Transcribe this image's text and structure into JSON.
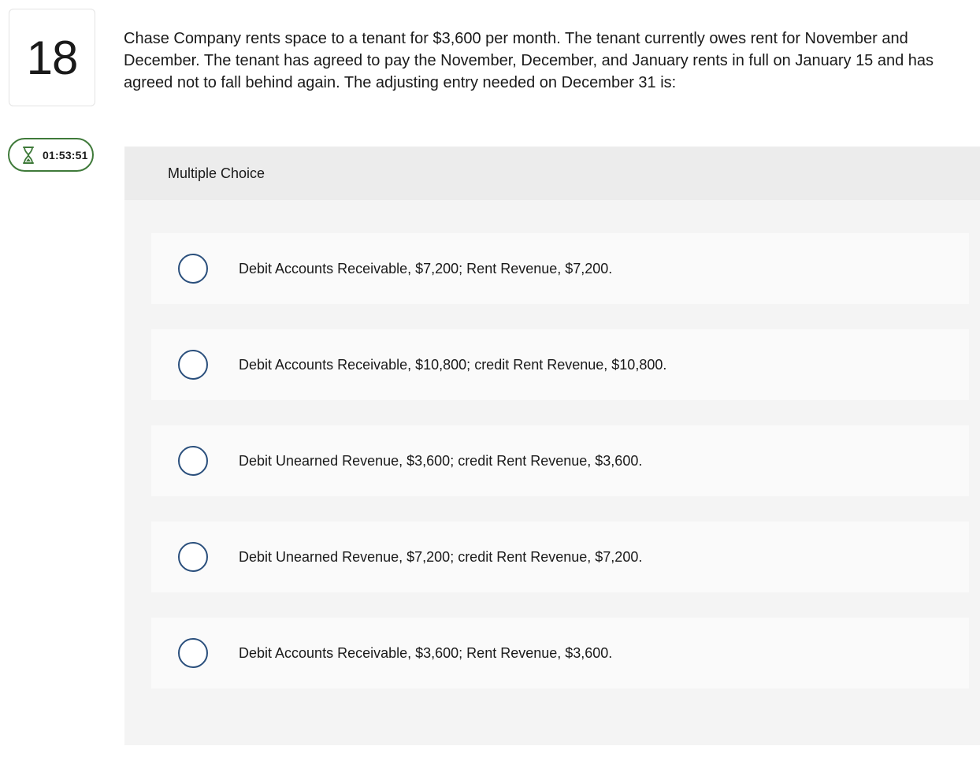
{
  "question": {
    "number": "18",
    "text": "Chase Company rents space to a tenant for $3,600 per month. The tenant currently owes rent for November and December. The tenant has agreed to pay the November, December, and January rents in full on January 15 and has agreed not to fall behind again. The adjusting entry needed on December 31 is:"
  },
  "timer": {
    "icon": "hourglass-icon",
    "value": "01:53:51",
    "color": "#3f7a3a"
  },
  "multiple_choice": {
    "header": "Multiple Choice",
    "options": [
      {
        "label": "Debit Accounts Receivable, $7,200; Rent Revenue, $7,200.",
        "selected": false
      },
      {
        "label": "Debit Accounts Receivable, $10,800; credit Rent Revenue, $10,800.",
        "selected": false
      },
      {
        "label": "Debit Unearned Revenue, $3,600; credit Rent Revenue, $3,600.",
        "selected": false
      },
      {
        "label": "Debit Unearned Revenue, $7,200; credit Rent Revenue, $7,200.",
        "selected": false
      },
      {
        "label": "Debit Accounts Receivable, $3,600; Rent Revenue, $3,600.",
        "selected": false
      }
    ],
    "radio_color": "#2a4f7c"
  }
}
